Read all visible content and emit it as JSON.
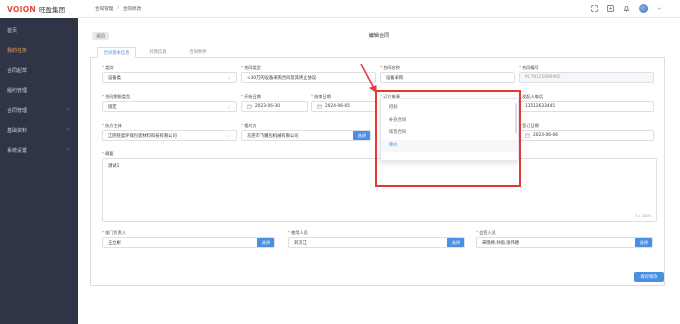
{
  "brand": {
    "logo": "VOION",
    "company": "旺盈集团"
  },
  "sidebar": {
    "items": [
      {
        "label": "首页",
        "active": false,
        "expandable": false
      },
      {
        "label": "我的任务",
        "active": true,
        "expandable": false
      },
      {
        "label": "合同起草",
        "active": false,
        "expandable": false
      },
      {
        "label": "履约管理",
        "active": false,
        "expandable": false
      },
      {
        "label": "合同管理",
        "active": false,
        "expandable": true
      },
      {
        "label": "基础资料",
        "active": false,
        "expandable": true
      },
      {
        "label": "系统设置",
        "active": false,
        "expandable": true
      }
    ]
  },
  "breadcrumb": {
    "first": "合同管理",
    "sep": "/",
    "second": "合同修改"
  },
  "header_icons": [
    "expand-icon",
    "fullscreen-icon",
    "bell-icon"
  ],
  "page": {
    "back_label": "返回",
    "title": "编辑合同"
  },
  "tabs": [
    "合同基本信息",
    "付款信息",
    "合同附件"
  ],
  "form": {
    "category": {
      "label": "类别",
      "value": "设备类"
    },
    "contract_type": {
      "label": "合同类型",
      "value": "<30万的设备采购合同及其终止协议"
    },
    "contract_name": {
      "label": "合同名称",
      "value": "设备采购"
    },
    "contract_no": {
      "label": "合同编号",
      "value": "PC78125896965"
    },
    "period_type": {
      "label": "合同期限类型",
      "value": "固定"
    },
    "start_date": {
      "label": "开始日期",
      "value": "2023-06-30"
    },
    "end_date": {
      "label": "结束日期",
      "value": "2024-06-05"
    },
    "source": {
      "label": "订立来源",
      "value": "降价"
    },
    "phone": {
      "label": "发起人电话",
      "value": "13512633445"
    },
    "executor": {
      "label": "执方主体",
      "value": "江阴旺盈环保包装材料科技有限公司"
    },
    "counterparty": {
      "label": "相对方",
      "value": "东莞市飞耀包机械有限公司",
      "button": "选择"
    },
    "sign_date": {
      "label": "签订日期",
      "value": "2023-06-06"
    },
    "summary": {
      "label": "摘要",
      "value": "测试1",
      "count": "3 / 1000"
    },
    "dept_head": {
      "label": "部门负责人",
      "value": "王立彬",
      "button": "选择"
    },
    "user": {
      "label": "使用人员",
      "value": "刘汉江",
      "button": "选择"
    },
    "cc": {
      "label": "会签人员",
      "value": "宋晓婷,孙雨,张伟德",
      "button": "选择"
    }
  },
  "dropdown": {
    "options": [
      "招标",
      "补充合同",
      "续签合同",
      "降价"
    ],
    "selected": "降价"
  },
  "save_label": "保存修改",
  "colors": {
    "accent": "#4a90e2",
    "active_nav": "#f29f4e",
    "highlight": "#e53935",
    "sidebar": "#2f3447"
  }
}
